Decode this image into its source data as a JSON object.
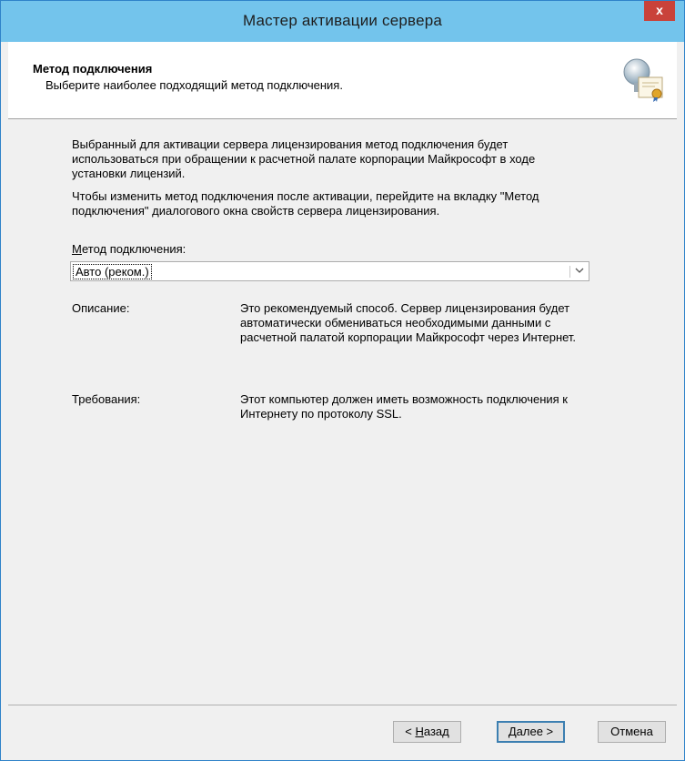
{
  "window": {
    "title": "Мастер активации сервера",
    "close": "x"
  },
  "header": {
    "title": "Метод подключения",
    "subtitle": "Выберите наиболее подходящий метод подключения.",
    "icon": "license-server-icon"
  },
  "content": {
    "para1": "Выбранный для активации сервера лицензирования метод подключения будет использоваться при обращении к расчетной палате корпорации Майкрософт в ходе установки лицензий.",
    "para2": "Чтобы изменить метод подключения после активации, перейдите на вкладку \"Метод подключения\" диалогового окна свойств сервера лицензирования.",
    "method_label_accel": "М",
    "method_label_rest": "етод подключения:",
    "method_selected": "Авто (реком.)",
    "description_label": "Описание:",
    "description_text": "Это рекомендуемый способ. Сервер лицензирования будет автоматически обмениваться необходимыми данными с расчетной палатой корпорации Майкрософт через Интернет.",
    "requirements_label": "Требования:",
    "requirements_text": "Этот компьютер должен иметь возможность подключения к Интернету по протоколу SSL."
  },
  "buttons": {
    "back_prefix": "< ",
    "back_accel": "Н",
    "back_rest": "азад",
    "next_accel": "Д",
    "next_rest": "алее >",
    "cancel": "Отмена"
  }
}
